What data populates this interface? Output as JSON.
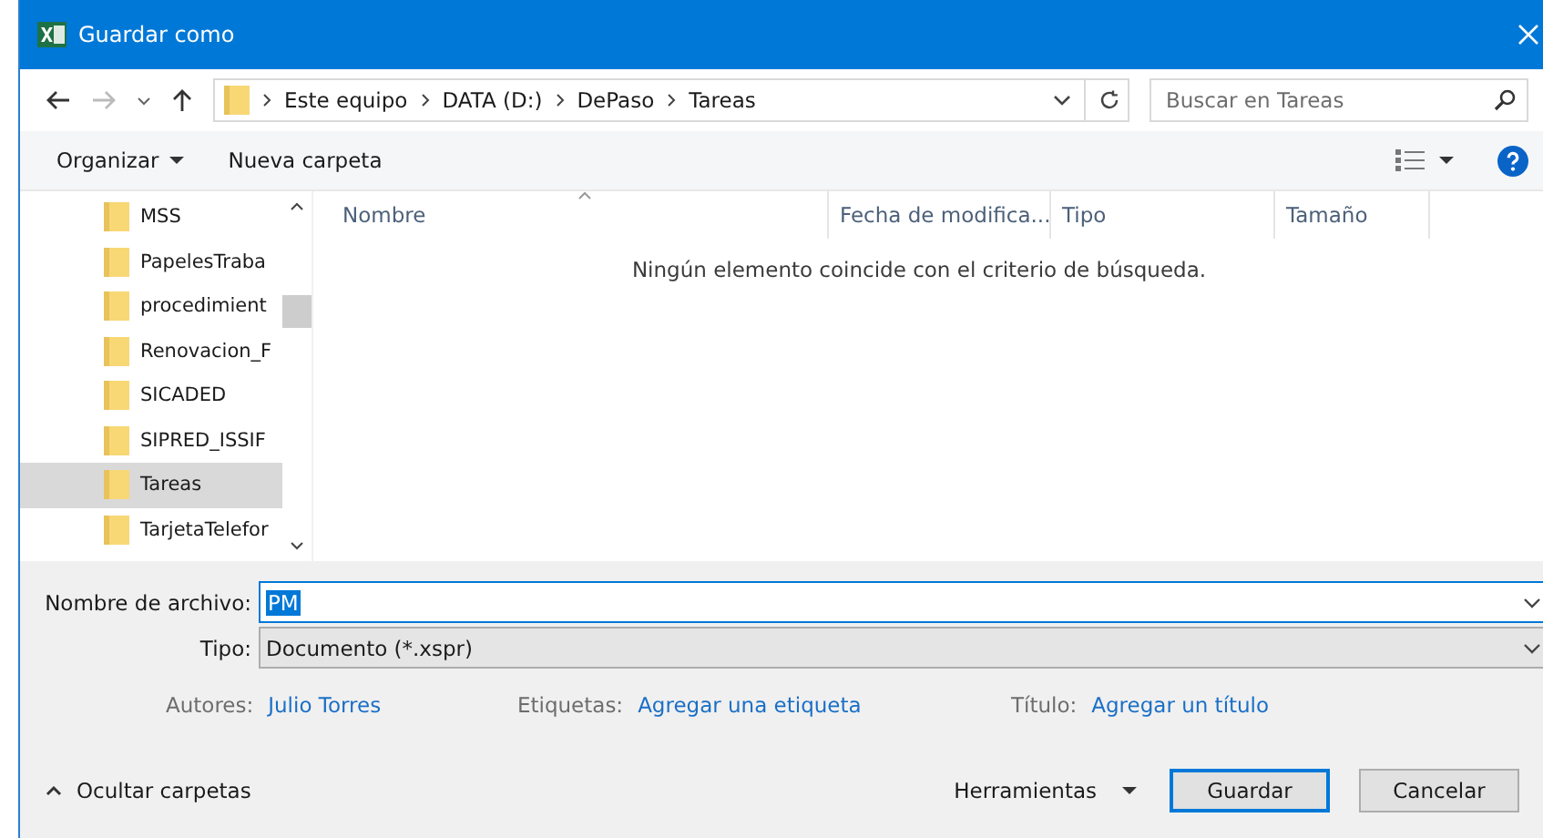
{
  "window": {
    "title": "Guardar como"
  },
  "address": {
    "crumbs": [
      "Este equipo",
      "DATA (D:)",
      "DePaso",
      "Tareas"
    ],
    "search_placeholder": "Buscar en Tareas"
  },
  "toolbar": {
    "organize": "Organizar",
    "new_folder": "Nueva carpeta"
  },
  "sidebar": {
    "items": [
      {
        "label": "MSS",
        "selected": false
      },
      {
        "label": "PapelesTraba",
        "selected": false
      },
      {
        "label": "procedimient",
        "selected": false
      },
      {
        "label": "Renovacion_F",
        "selected": false
      },
      {
        "label": "SICADED",
        "selected": false
      },
      {
        "label": "SIPRED_ISSIF",
        "selected": false
      },
      {
        "label": "Tareas",
        "selected": true
      },
      {
        "label": "TarjetaTelefor",
        "selected": false
      }
    ]
  },
  "file_list": {
    "columns": [
      "Nombre",
      "Fecha de modifica...",
      "Tipo",
      "Tamaño"
    ],
    "empty_message": "Ningún elemento coincide con el criterio de búsqueda."
  },
  "form": {
    "filename_label": "Nombre de archivo:",
    "filename": "PM",
    "type_label": "Tipo:",
    "type": "Documento (*.xspr)",
    "meta": [
      {
        "label": "Autores:",
        "value": "Julio Torres"
      },
      {
        "label": "Etiquetas:",
        "value": "Agregar una etiqueta"
      },
      {
        "label": "Título:",
        "value": "Agregar un título"
      }
    ]
  },
  "footer": {
    "hide_folders": "Ocultar carpetas",
    "tools": "Herramientas",
    "save": "Guardar",
    "cancel": "Cancelar"
  }
}
